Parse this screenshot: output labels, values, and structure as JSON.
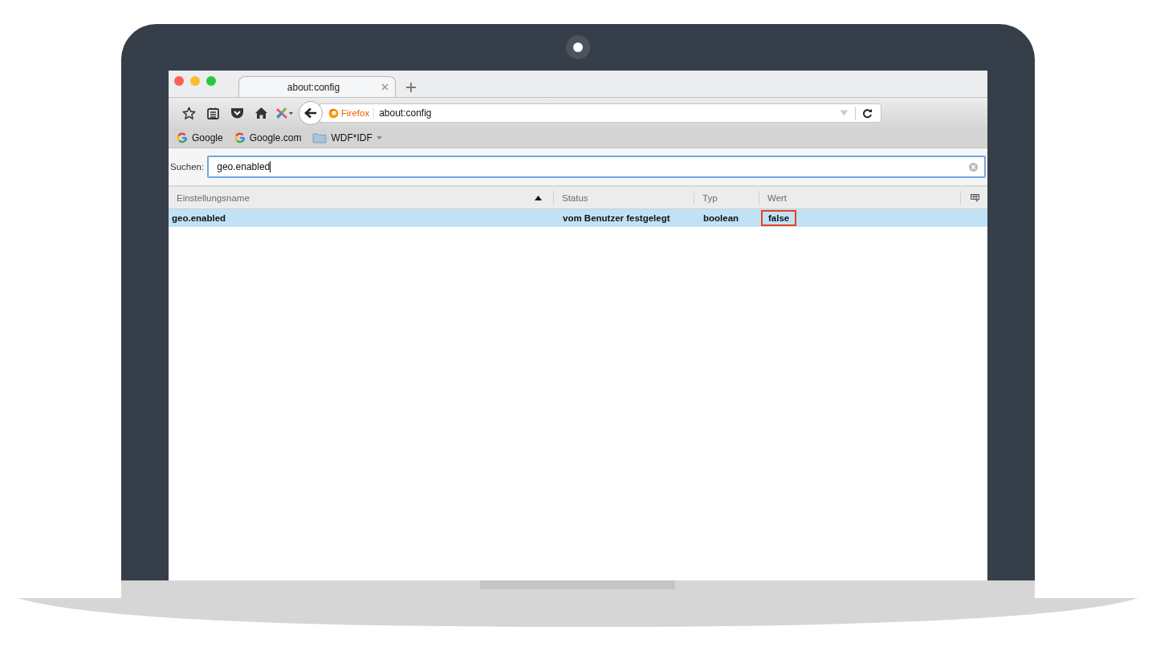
{
  "tabs": [
    {
      "title": "about:config",
      "selected": true
    }
  ],
  "address_bar": {
    "identity_label": "Firefox",
    "url": "about:config"
  },
  "bookmarks": [
    {
      "label": "Google",
      "kind": "site"
    },
    {
      "label": "Google.com",
      "kind": "site"
    },
    {
      "label": "WDF*IDF",
      "kind": "folder"
    }
  ],
  "search": {
    "label": "Suchen:",
    "value": "geo.enabled"
  },
  "table": {
    "columns": [
      {
        "label": "Einstellungsname",
        "sorted": true
      },
      {
        "label": "Status",
        "sorted": false
      },
      {
        "label": "Typ",
        "sorted": false
      },
      {
        "label": "Wert",
        "sorted": false
      }
    ],
    "rows": [
      {
        "selected": true,
        "cells": [
          {
            "text": "geo.enabled",
            "highlighted": false
          },
          {
            "text": "vom Benutzer festgelegt",
            "highlighted": false
          },
          {
            "text": "boolean",
            "highlighted": false
          },
          {
            "text": "false",
            "highlighted": true
          }
        ]
      }
    ]
  }
}
